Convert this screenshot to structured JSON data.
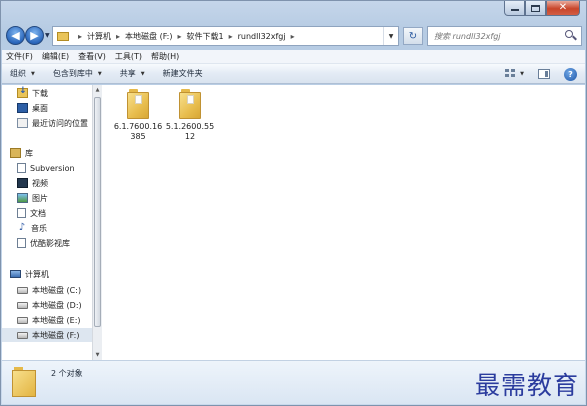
{
  "address": {
    "crumbs": [
      "计算机",
      "本地磁盘 (F:)",
      "软件下载1",
      "rundll32xfgj"
    ]
  },
  "search": {
    "placeholder": "搜索 rundll32xfgj"
  },
  "menu": [
    "文件(F)",
    "编辑(E)",
    "查看(V)",
    "工具(T)",
    "帮助(H)"
  ],
  "toolbar": [
    "组织",
    "包含到库中",
    "共享",
    "新建文件夹"
  ],
  "nav": {
    "favorites": [
      "下载",
      "桌面",
      "最近访问的位置"
    ],
    "library_label": "库",
    "libraries": [
      "Subversion",
      "视频",
      "图片",
      "文档",
      "音乐",
      "优酷影视库"
    ],
    "computer_label": "计算机",
    "drives": [
      "本地磁盘 (C:)",
      "本地磁盘 (D:)",
      "本地磁盘 (E:)",
      "本地磁盘 (F:)"
    ],
    "selected": "本地磁盘 (F:)"
  },
  "files": [
    {
      "name": "6.1.7600.16385"
    },
    {
      "name": "5.1.2600.5512"
    }
  ],
  "status": {
    "count": "2 个对象"
  },
  "watermark": "最需教育"
}
